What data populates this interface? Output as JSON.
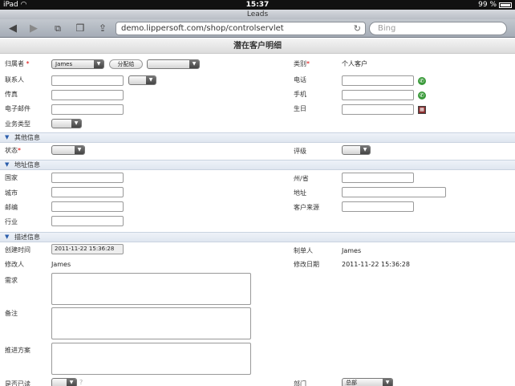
{
  "status": {
    "carrier": "iPad",
    "wifi_icon": "wifi-icon",
    "time": "15:37",
    "battery": "99 %"
  },
  "browser": {
    "title": "Leads",
    "url": "demo.lippersoft.com/shop/controlservlet",
    "search_placeholder": "Bing",
    "icons": [
      "back-icon",
      "forward-icon",
      "tabs-icon",
      "bookmarks-icon",
      "share-icon",
      "reload-icon"
    ]
  },
  "page": {
    "heading": "潜在客户明细"
  },
  "form": {
    "owner_label": "归属者",
    "owner_value": "James",
    "assign_button": "分配给",
    "assign_select": "",
    "category_label": "类别",
    "category_value": "个人客户",
    "contact_label": "联系人",
    "contact_value": "",
    "contact_select": "",
    "phone_label": "电话",
    "phone_value": "",
    "fax_label": "传真",
    "fax_value": "",
    "mobile_label": "手机",
    "mobile_value": "",
    "email_label": "电子邮件",
    "email_value": "",
    "birthday_label": "生日",
    "birthday_value": "",
    "business_type_label": "业务类型",
    "business_type_value": "",
    "section_other": "其他信息",
    "status_label": "状态",
    "status_value": "",
    "rating_label": "评级",
    "rating_value": "",
    "section_address": "地址信息",
    "country_label": "国家",
    "country_value": "",
    "state_label": "州/省",
    "state_value": "",
    "city_label": "城市",
    "city_value": "",
    "address_label": "地址",
    "address_value": "",
    "zip_label": "邮编",
    "zip_value": "",
    "source_label": "客户来源",
    "source_value": "",
    "industry_label": "行业",
    "industry_value": "",
    "section_desc": "描述信息",
    "created_label": "创建时间",
    "created_value": "2011-11-22 15:36:28",
    "creator_label": "制单人",
    "creator_value": "James",
    "modifier_label": "修改人",
    "modifier_value": "James",
    "modified_label": "修改日期",
    "modified_value": "2011-11-22 15:36:28",
    "needs_label": "需求",
    "notes_label": "备注",
    "plan_label": "推进方案",
    "referral_label": "是否已读",
    "referral_value": "",
    "help_icon": "?",
    "dept_label": "部门",
    "dept_value": "总部"
  },
  "colors": {
    "required": "#dd0000",
    "section_chevron": "#2a5dab",
    "phone_icon": "#3a9a3a"
  }
}
